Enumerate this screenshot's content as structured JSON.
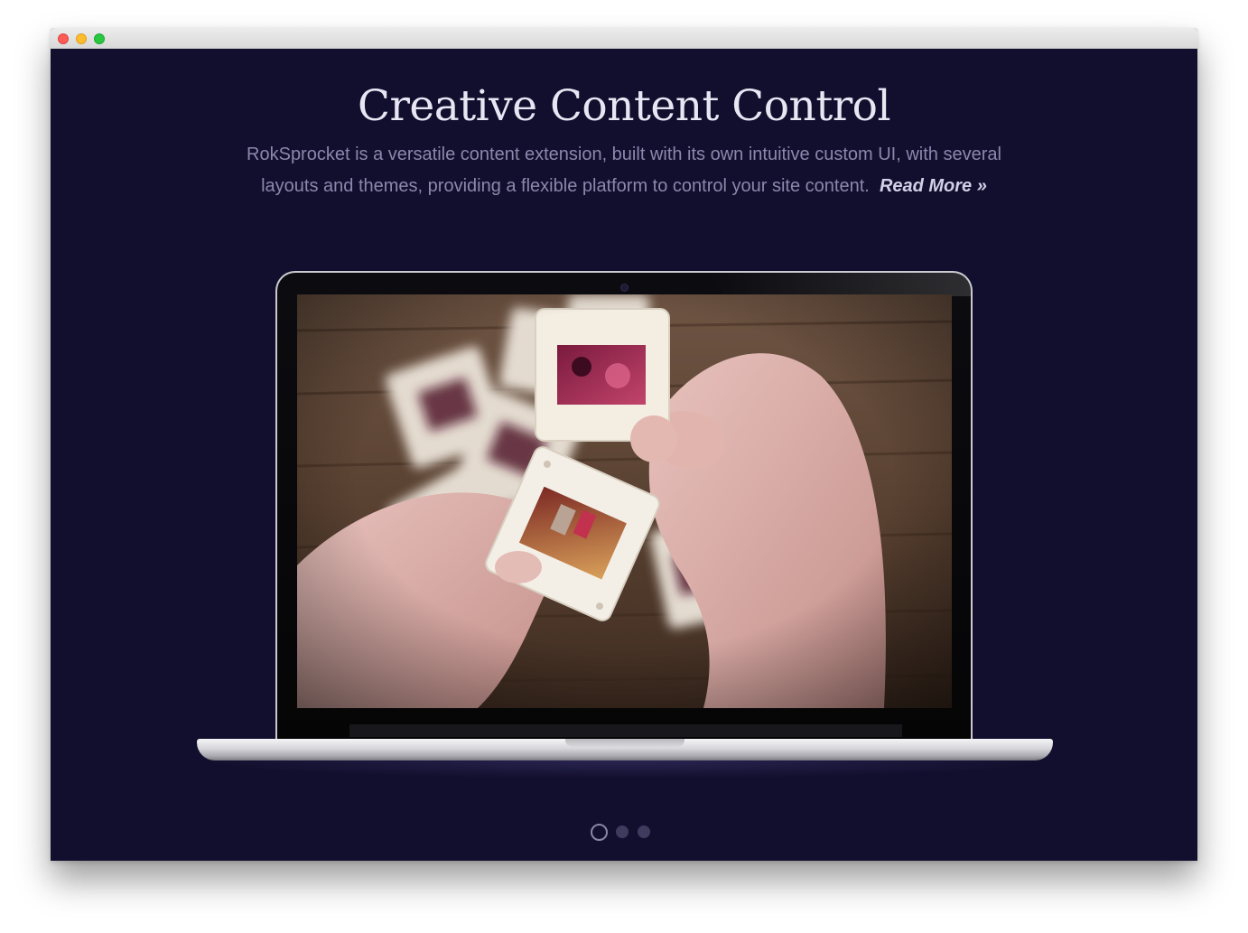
{
  "window": {
    "controls": [
      "close",
      "minimize",
      "zoom"
    ]
  },
  "hero": {
    "title": "Creative Content Control",
    "description": "RokSprocket is a versatile content extension, built with its own intuitive custom UI, with several layouts and themes, providing a flexible platform to control your site content.",
    "read_more": "Read More »"
  },
  "slider": {
    "slides": 3,
    "active_slide": 1
  },
  "colors": {
    "background": "#120f2e",
    "title": "#e9e6f4",
    "text": "#8c87ad",
    "link": "#d2cfe6"
  }
}
